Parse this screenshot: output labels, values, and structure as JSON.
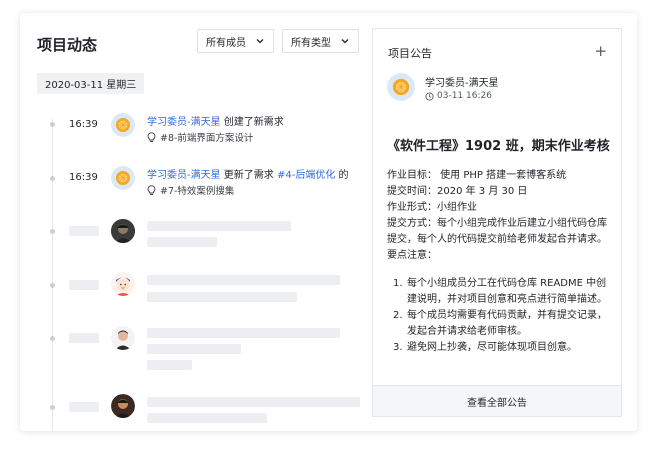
{
  "header": {
    "title": "项目动态"
  },
  "filters": {
    "members": "所有成员",
    "types": "所有类型"
  },
  "date_chip": "2020-03-11 星期三",
  "feed": [
    {
      "time": "16:39",
      "actor": "学习委员-满天星",
      "action": "创建了新需求",
      "sub": "#8-前端界面方案设计"
    },
    {
      "time": "16:39",
      "actor": "学习委员-满天星",
      "action": "更新了需求",
      "target": "#4-后端优化",
      "tail": "的",
      "sub": "#7-特效案例搜集"
    }
  ],
  "notice": {
    "title": "项目公告",
    "add": "+",
    "author": "学习委员-满天星",
    "time": "03-11 16:26",
    "heading": "《软件工程》1902 班，期末作业考核",
    "lines": [
      "作业目标： 使用 PHP 搭建一套博客系统",
      "提交时间：2020 年 3 月 30 日",
      "作业形式：小组作业",
      "提交方式：每个小组完成作业后建立小组代码仓库提交，每个人的代码提交前给老师发起合并请求。",
      "要点注意："
    ],
    "points": [
      "每个小组成员分工在代码仓库 README 中创建说明，并对项目创意和亮点进行简单描述。",
      "每个成员均需要有代码贡献，并有提交记录，发起合并请求给老师审核。",
      "避免网上抄袭，尽可能体现项目创意。"
    ],
    "footer": "查看全部公告"
  },
  "colors": {
    "link": "#2f6bdc",
    "orange": "#f5a623",
    "skeleton": "#eceef1"
  }
}
